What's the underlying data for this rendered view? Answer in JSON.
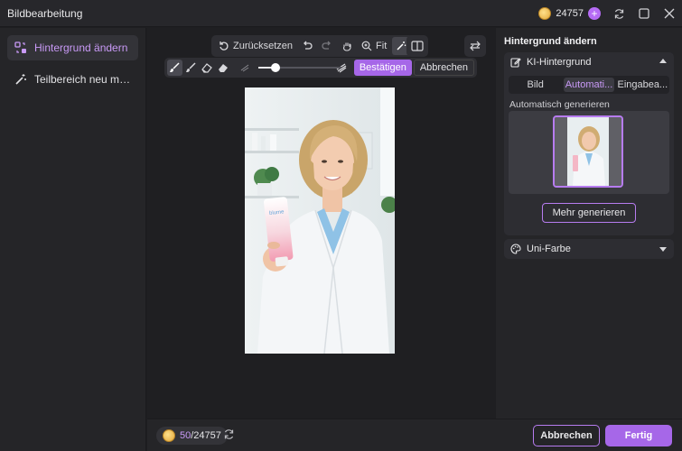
{
  "window": {
    "title": "Bildbearbeitung",
    "credits": "24757"
  },
  "sidebar": {
    "items": [
      {
        "label": "Hintergrund ändern"
      },
      {
        "label": "Teilbereich neu mal..."
      }
    ]
  },
  "toolbar": {
    "reset_label": "Zurücksetzen",
    "fit_label": "Fit",
    "confirm_label": "Bestätigen",
    "cancel_label": "Abbrechen",
    "brush_size": 0.2
  },
  "panel": {
    "title": "Hintergrund ändern",
    "ai_bg": {
      "title": "KI-Hintergrund",
      "tabs": [
        "Bild",
        "Automati...",
        "Eingabea..."
      ],
      "active_tab": 1,
      "auto_label": "Automatisch generieren",
      "more_label": "Mehr generieren"
    },
    "solid": {
      "title": "Uni-Farbe"
    }
  },
  "footer": {
    "credits_used": "50",
    "credits_sep": "/24757",
    "cancel_label": "Abbrechen",
    "done_label": "Fertig"
  },
  "photo": {
    "tube_text": "blume"
  },
  "colors": {
    "accent": "#a667e8",
    "accent_light": "#c99af7"
  }
}
